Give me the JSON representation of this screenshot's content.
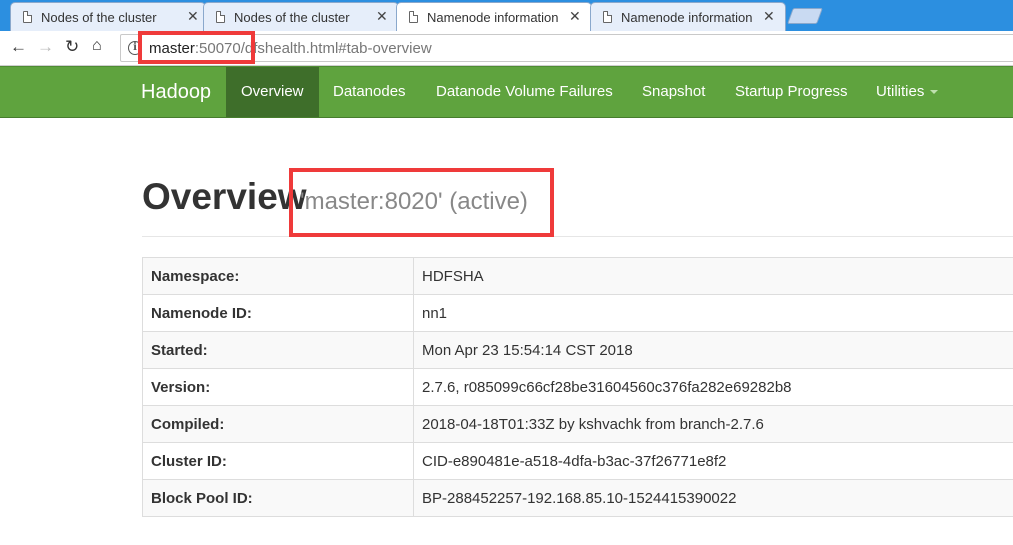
{
  "browser": {
    "tabs": [
      {
        "title": "Nodes of the cluster",
        "active": false
      },
      {
        "title": "Nodes of the cluster",
        "active": false
      },
      {
        "title": "Namenode information",
        "active": true
      },
      {
        "title": "Namenode information",
        "active": false
      }
    ],
    "close_glyph": "✕",
    "url_host": "master",
    "url_rest": ":50070/dfshealth.html#tab-overview"
  },
  "navbar": {
    "brand": "Hadoop",
    "items": [
      {
        "label": "Overview",
        "active": true
      },
      {
        "label": "Datanodes",
        "active": false
      },
      {
        "label": "Datanode Volume Failures",
        "active": false
      },
      {
        "label": "Snapshot",
        "active": false
      },
      {
        "label": "Startup Progress",
        "active": false
      },
      {
        "label": "Utilities",
        "active": false,
        "dropdown": true
      }
    ]
  },
  "overview": {
    "title": "Overview",
    "subtitle": "'master:8020' (active)",
    "rows": [
      {
        "key": "Namespace:",
        "value": "HDFSHA"
      },
      {
        "key": "Namenode ID:",
        "value": "nn1"
      },
      {
        "key": "Started:",
        "value": "Mon Apr 23 15:54:14 CST 2018"
      },
      {
        "key": "Version:",
        "value": "2.7.6, r085099c66cf28be31604560c376fa282e69282b8"
      },
      {
        "key": "Compiled:",
        "value": "2018-04-18T01:33Z by kshvachk from branch-2.7.6"
      },
      {
        "key": "Cluster ID:",
        "value": "CID-e890481e-a518-4dfa-b3ac-37f26771e8f2"
      },
      {
        "key": "Block Pool ID:",
        "value": "BP-288452257-192.168.85.10-1524415390022"
      }
    ]
  },
  "colors": {
    "navbar": "#5fa33e",
    "navbar_active": "#3e6e2a",
    "annotation": "#ef3a3a",
    "tabstrip": "#2c8fe0"
  }
}
